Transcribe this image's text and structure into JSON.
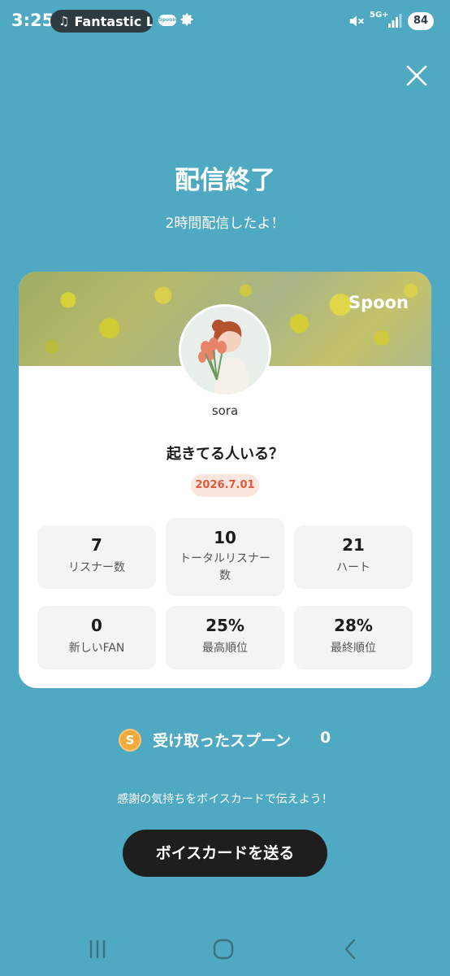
{
  "status_bar": {
    "time": "3:25",
    "media_title": "Fantastic L",
    "spoon_mini": "Spoon",
    "network": "5G+",
    "battery": "84"
  },
  "header": {
    "title": "配信終了",
    "subtitle": "2時間配信したよ！"
  },
  "card": {
    "brand": "Spoon",
    "username": "sora",
    "broadcast_title": "起きてる人いる？",
    "date": "2026.7.01",
    "stats": [
      {
        "value": "7",
        "label": "リスナー数"
      },
      {
        "value": "10",
        "label_line1": "トータルリスナー",
        "label_line2": "数"
      },
      {
        "value": "21",
        "label": "ハート"
      },
      {
        "value": "0",
        "label": "新しいFAN"
      },
      {
        "value": "25%",
        "label": "最高順位"
      },
      {
        "value": "28%",
        "label": "最終順位"
      }
    ]
  },
  "spoons": {
    "coin": "S",
    "label": "受け取ったスプーン",
    "count": "0"
  },
  "thanks_text": "感謝の気持ちをボイスカードで伝えよう！",
  "send_button": "ボイスカードを送る",
  "colors": {
    "background": "#4fa9c2",
    "date_accent": "#e0593a",
    "button": "#1e1e1e",
    "coin": "#f2a93b"
  }
}
